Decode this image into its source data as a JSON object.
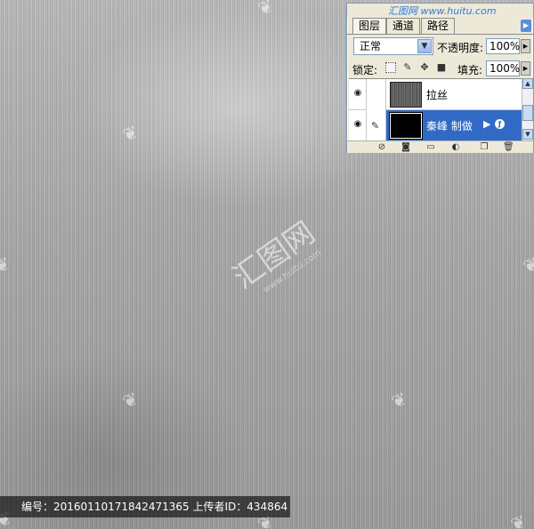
{
  "panel": {
    "tabs": [
      "图层",
      "通道",
      "路径"
    ],
    "blend_mode": "正常",
    "opacity_label": "不透明度:",
    "opacity_value": "100%",
    "lock_label": "锁定:",
    "fill_label": "填充:",
    "fill_value": "100%",
    "layers": [
      {
        "name": "拉丝",
        "visible": true,
        "selected": false
      },
      {
        "name": "秦峰  制做",
        "visible": true,
        "selected": true
      }
    ]
  },
  "watermark": {
    "site": "汇图网 www.huitu.com",
    "logo": "汇图网",
    "sub": "www.huitu.com"
  },
  "footer": {
    "text": "编号：20160110171842471365 上传者ID：434864"
  },
  "colors": {
    "selection": "#316ac5",
    "panel_bg": "#ece9d8",
    "metal_base": "#a9a9a9"
  }
}
